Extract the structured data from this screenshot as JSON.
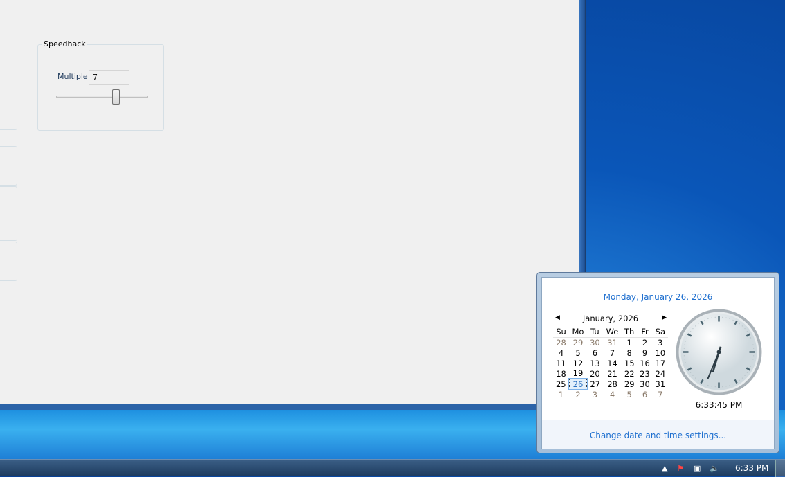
{
  "speedhack": {
    "group_title": "Speedhack",
    "multiple_label": "Multiple:",
    "multiple_value": "7",
    "slider_fraction": 0.65
  },
  "calendar_flyout": {
    "long_date": "Monday, January 26, 2026",
    "month_title": "January, 2026",
    "weekdays": [
      "Su",
      "Mo",
      "Tu",
      "We",
      "Th",
      "Fr",
      "Sa"
    ],
    "weeks": [
      [
        "28",
        "29",
        "30",
        "31",
        "1",
        "2",
        "3"
      ],
      [
        "4",
        "5",
        "6",
        "7",
        "8",
        "9",
        "10"
      ],
      [
        "11",
        "12",
        "13",
        "14",
        "15",
        "16",
        "17"
      ],
      [
        "18",
        "19",
        "20",
        "21",
        "22",
        "23",
        "24"
      ],
      [
        "25",
        "26",
        "27",
        "28",
        "29",
        "30",
        "31"
      ],
      [
        "1",
        "2",
        "3",
        "4",
        "5",
        "6",
        "7"
      ]
    ],
    "selected_day": "26",
    "time": "6:33:45 PM",
    "clock": {
      "hours": 18,
      "minutes": 33,
      "seconds": 45
    },
    "settings_link": "Change date and time settings..."
  },
  "taskbar": {
    "clock": "6:33 PM"
  }
}
